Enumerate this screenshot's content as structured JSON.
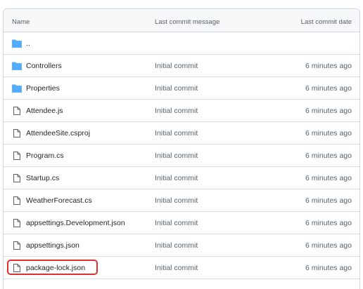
{
  "table": {
    "columns": {
      "name": "Name",
      "message": "Last commit message",
      "date": "Last commit date"
    },
    "parent_link": "..",
    "rows": [
      {
        "name": "Controllers",
        "message": "Initial commit",
        "date": "6 minutes ago",
        "icon": "folder-icon"
      },
      {
        "name": "Properties",
        "message": "Initial commit",
        "date": "6 minutes ago",
        "icon": "folder-icon"
      },
      {
        "name": "Attendee.js",
        "message": "Initial commit",
        "date": "6 minutes ago",
        "icon": "file-icon"
      },
      {
        "name": "AttendeeSite.csproj",
        "message": "Initial commit",
        "date": "6 minutes ago",
        "icon": "file-icon"
      },
      {
        "name": "Program.cs",
        "message": "Initial commit",
        "date": "6 minutes ago",
        "icon": "file-icon"
      },
      {
        "name": "Startup.cs",
        "message": "Initial commit",
        "date": "6 minutes ago",
        "icon": "file-icon"
      },
      {
        "name": "WeatherForecast.cs",
        "message": "Initial commit",
        "date": "6 minutes ago",
        "icon": "file-icon"
      },
      {
        "name": "appsettings.Development.json",
        "message": "Initial commit",
        "date": "6 minutes ago",
        "icon": "file-icon"
      },
      {
        "name": "appsettings.json",
        "message": "Initial commit",
        "date": "6 minutes ago",
        "icon": "file-icon"
      },
      {
        "name": "package-lock.json",
        "message": "Initial commit",
        "date": "6 minutes ago",
        "icon": "file-icon",
        "highlighted": true
      }
    ]
  },
  "colors": {
    "folder": "#54aeff",
    "file": "#57606a",
    "highlight": "#e0302d",
    "border": "#d0d7de",
    "header_bg": "#f6f8fa"
  }
}
